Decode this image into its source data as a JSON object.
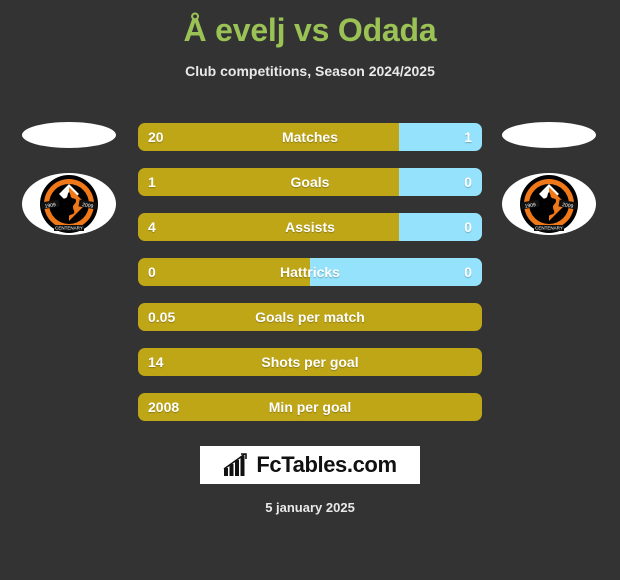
{
  "header": {
    "title": "Å evelj vs Odada",
    "subtitle": "Club competitions, Season 2024/2025",
    "title_color": "#9ac254"
  },
  "theme": {
    "background": "#333333",
    "home_bar_color": "#bfa617",
    "away_bar_color": "#94e2fb",
    "text_color": "#ffffff"
  },
  "crests": {
    "left": {
      "name": "dundee-united-crest",
      "alt": "Dundee United"
    },
    "right": {
      "name": "dundee-united-crest",
      "alt": "Dundee United"
    }
  },
  "chart_data": {
    "type": "bar",
    "title": "Å evelj vs Odada",
    "subtitle": "Club competitions, Season 2024/2025",
    "orientation": "horizontal-diverging",
    "legend": [
      "Å evelj",
      "Odada"
    ],
    "categories": [
      "Matches",
      "Goals",
      "Assists",
      "Hattricks",
      "Goals per match",
      "Shots per goal",
      "Min per goal"
    ],
    "series": [
      {
        "name": "Å evelj",
        "values": [
          "20",
          "1",
          "4",
          "0",
          "0.05",
          "14",
          "2008"
        ]
      },
      {
        "name": "Odada",
        "values": [
          "1",
          "0",
          "0",
          "0",
          null,
          null,
          null
        ]
      }
    ],
    "rows": [
      {
        "label": "Matches",
        "home": "20",
        "away": "1",
        "home_pct": 76,
        "away_pct": 24,
        "split": true
      },
      {
        "label": "Goals",
        "home": "1",
        "away": "0",
        "home_pct": 76,
        "away_pct": 24,
        "split": true
      },
      {
        "label": "Assists",
        "home": "4",
        "away": "0",
        "home_pct": 76,
        "away_pct": 24,
        "split": true
      },
      {
        "label": "Hattricks",
        "home": "0",
        "away": "0",
        "home_pct": 50,
        "away_pct": 50,
        "split": true
      },
      {
        "label": "Goals per match",
        "home": "0.05",
        "away": "",
        "home_pct": 100,
        "away_pct": 0,
        "split": false
      },
      {
        "label": "Shots per goal",
        "home": "14",
        "away": "",
        "home_pct": 100,
        "away_pct": 0,
        "split": false
      },
      {
        "label": "Min per goal",
        "home": "2008",
        "away": "",
        "home_pct": 100,
        "away_pct": 0,
        "split": false
      }
    ]
  },
  "brand": {
    "text": "FcTables.com",
    "icon": "bar-chart-growth-icon"
  },
  "footer": {
    "date": "5 january 2025"
  }
}
